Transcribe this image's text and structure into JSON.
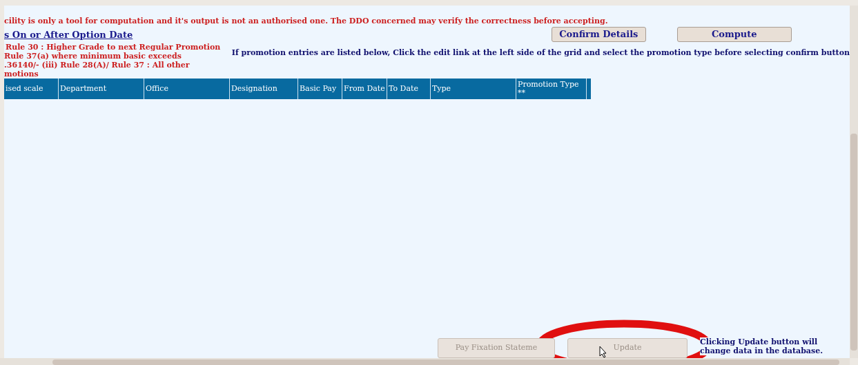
{
  "disclaimer": "cility is only a tool for computation and it's output is not an authorised one. The DDO concerned may verify the correctness before accepting.",
  "option_link": "s On or After Option Date",
  "rules_note": [
    "Rule 30 : Higher Grade to next Regular Promotion",
    "Rule 37(a) where minimum basic exceeds",
    ".36140/- (iii) Rule 28(A)/ Rule 37 : All other",
    "motions"
  ],
  "top_buttons": [
    {
      "label": "Confirm Details",
      "disabled": false
    },
    {
      "label": "Compute",
      "disabled": false
    }
  ],
  "instruction": "If promotion entries are listed below, Click the edit link at the left side of the grid and select the promotion type before selecting confirm button",
  "table": {
    "columns": [
      "ised scale",
      "Department",
      "Office",
      "Designation",
      "Basic Pay",
      "From Date",
      "To Date",
      "Type",
      "Promotion Type **"
    ]
  },
  "bottom_buttons": [
    {
      "label": "Pay Fixation Stateme",
      "disabled": true
    },
    {
      "label": "Update",
      "disabled": true
    }
  ],
  "update_note": "Clicking Update button will change data in the database."
}
